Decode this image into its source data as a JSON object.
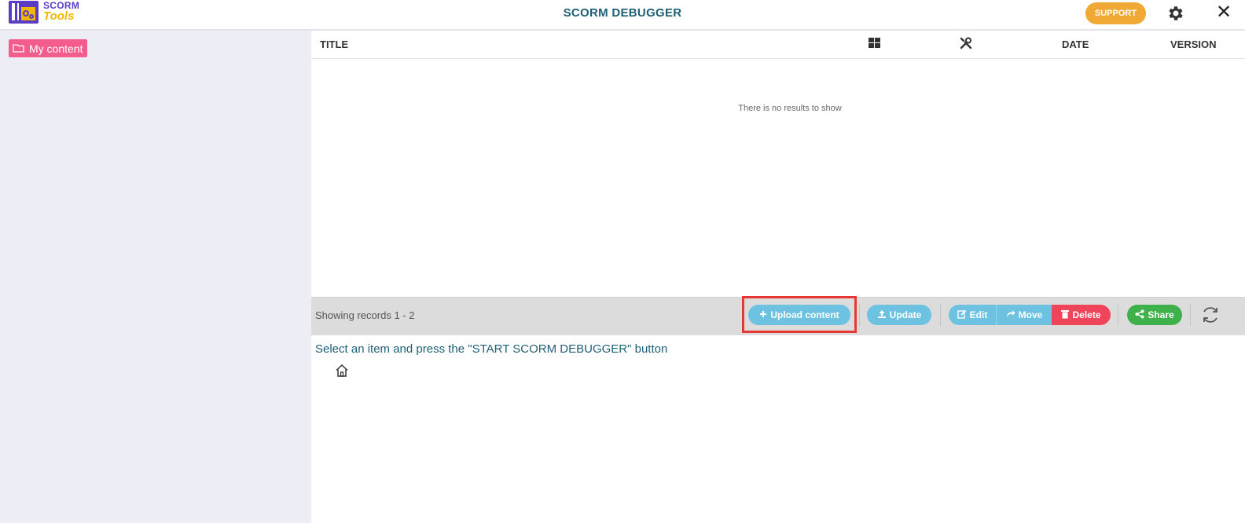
{
  "header": {
    "logo_line1": "SCORM",
    "logo_line2": "Tools",
    "title": "SCORM DEBUGGER",
    "support_label": "SUPPORT",
    "close_glyph": "✕"
  },
  "sidebar": {
    "items": [
      {
        "label": "My content",
        "icon": "folder-icon"
      }
    ]
  },
  "table": {
    "columns": {
      "title": "TITLE",
      "grid_icon": "grid-icon",
      "tools_icon": "tools-icon",
      "date": "DATE",
      "version": "VERSION"
    },
    "empty_message": "There is no results to show"
  },
  "footer": {
    "records_text": "Showing records 1 - 2",
    "buttons": {
      "upload": "Upload content",
      "update": "Update",
      "edit": "Edit",
      "move": "Move",
      "delete": "Delete",
      "share": "Share"
    }
  },
  "instruction": "Select an item and press the \"START SCORM DEBUGGER\" button",
  "colors": {
    "accent": "#1e5f75",
    "support": "#f0a934",
    "sidebar_item": "#f25d8e",
    "button_blue": "#6cc2e0",
    "button_delete": "#f0445a",
    "button_share": "#3fb14a",
    "highlight": "#e53935"
  }
}
